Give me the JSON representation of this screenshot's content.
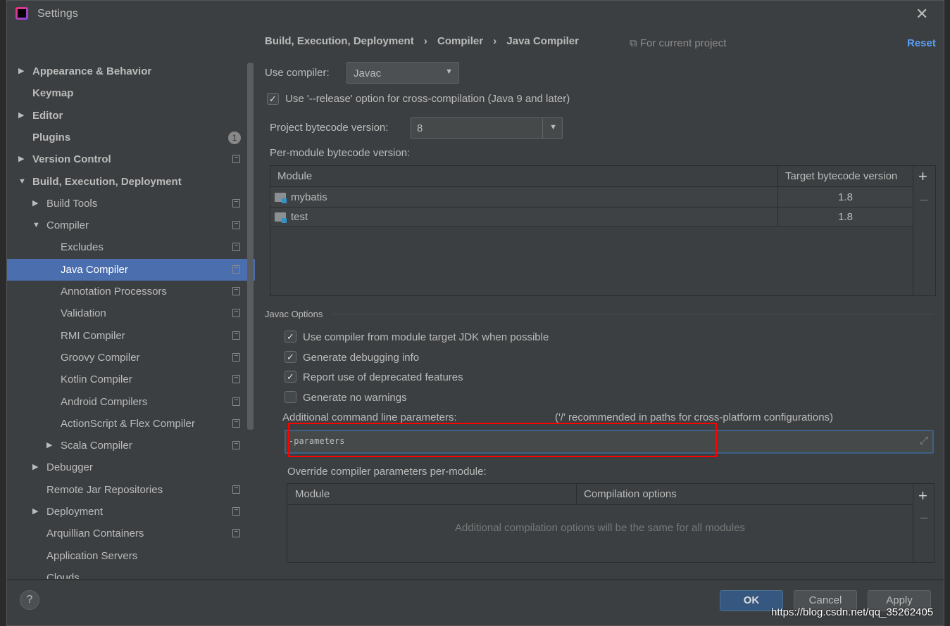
{
  "window": {
    "title": "Settings"
  },
  "search": {
    "placeholder": ""
  },
  "sidebar": {
    "items": [
      {
        "label": "Appearance & Behavior",
        "level": 0,
        "arrow": "▶",
        "bold": true
      },
      {
        "label": "Keymap",
        "level": 0,
        "bold": true
      },
      {
        "label": "Editor",
        "level": 0,
        "arrow": "▶",
        "bold": true
      },
      {
        "label": "Plugins",
        "level": 0,
        "bold": true,
        "badge": "1"
      },
      {
        "label": "Version Control",
        "level": 0,
        "arrow": "▶",
        "bold": true,
        "copy": true
      },
      {
        "label": "Build, Execution, Deployment",
        "level": 0,
        "arrow": "▼",
        "bold": true
      },
      {
        "label": "Build Tools",
        "level": 1,
        "arrow": "▶",
        "copy": true
      },
      {
        "label": "Compiler",
        "level": 1,
        "arrow": "▼",
        "copy": true
      },
      {
        "label": "Excludes",
        "level": 2,
        "copy": true
      },
      {
        "label": "Java Compiler",
        "level": 2,
        "copy": true,
        "selected": true
      },
      {
        "label": "Annotation Processors",
        "level": 2,
        "copy": true
      },
      {
        "label": "Validation",
        "level": 2,
        "copy": true
      },
      {
        "label": "RMI Compiler",
        "level": 2,
        "copy": true
      },
      {
        "label": "Groovy Compiler",
        "level": 2,
        "copy": true
      },
      {
        "label": "Kotlin Compiler",
        "level": 2,
        "copy": true
      },
      {
        "label": "Android Compilers",
        "level": 2,
        "copy": true
      },
      {
        "label": "ActionScript & Flex Compiler",
        "level": 2,
        "copy": true
      },
      {
        "label": "Scala Compiler",
        "level": 2,
        "arrow": "▶",
        "copy": true
      },
      {
        "label": "Debugger",
        "level": 1,
        "arrow": "▶"
      },
      {
        "label": "Remote Jar Repositories",
        "level": 1,
        "copy": true
      },
      {
        "label": "Deployment",
        "level": 1,
        "arrow": "▶",
        "copy": true
      },
      {
        "label": "Arquillian Containers",
        "level": 1,
        "copy": true
      },
      {
        "label": "Application Servers",
        "level": 1
      },
      {
        "label": "Clouds",
        "level": 1
      }
    ]
  },
  "breadcrumb": {
    "items": [
      "Build, Execution, Deployment",
      "Compiler",
      "Java Compiler"
    ],
    "sep": "›",
    "scope": "For current project",
    "reset": "Reset"
  },
  "main": {
    "use_compiler_label": "Use compiler:",
    "use_compiler_value": "Javac",
    "release_option": {
      "label": "Use '--release' option for cross-compilation (Java 9 and later)",
      "checked": true
    },
    "bytecode_label": "Project bytecode version:",
    "bytecode_value": "8",
    "per_module_label": "Per-module bytecode version:",
    "module_table": {
      "headers": [
        "Module",
        "Target bytecode version"
      ],
      "rows": [
        [
          "mybatis",
          "1.8"
        ],
        [
          "test",
          "1.8"
        ]
      ]
    },
    "javac_section": "Javac Options",
    "options": [
      {
        "label": "Use compiler from module target JDK when possible",
        "checked": true
      },
      {
        "label": "Generate debugging info",
        "checked": true
      },
      {
        "label": "Report use of deprecated features",
        "checked": true
      },
      {
        "label": "Generate no warnings",
        "checked": false
      }
    ],
    "additional_label": "Additional command line parameters:",
    "additional_hint": "('/' recommended in paths for cross-platform configurations)",
    "additional_value": "-parameters",
    "override_label": "Override compiler parameters per-module:",
    "override_table": {
      "headers": [
        "Module",
        "Compilation options"
      ],
      "empty": "Additional compilation options will be the same for all modules"
    }
  },
  "footer": {
    "help": "?",
    "ok": "OK",
    "cancel": "Cancel",
    "apply": "Apply"
  },
  "watermark": "https://blog.csdn.net/qq_35262405",
  "colors": {
    "accent": "#4b6eaf",
    "link": "#589df6",
    "highlight_box": "#ff0000"
  }
}
